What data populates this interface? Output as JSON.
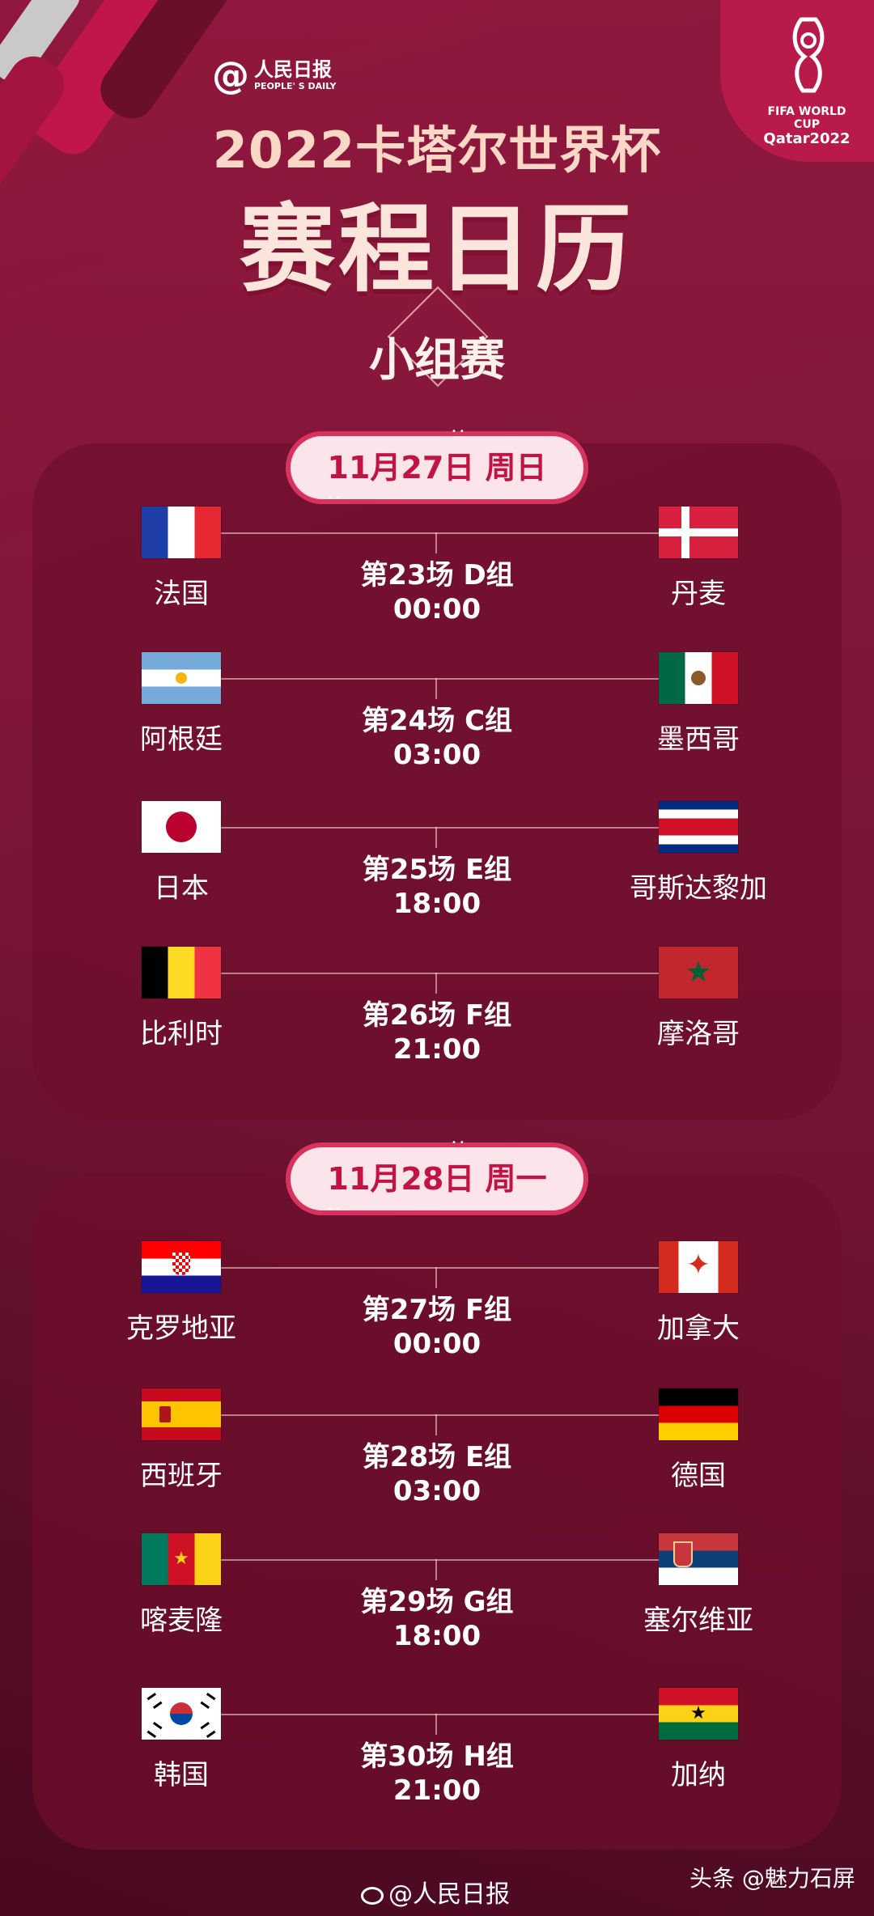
{
  "header": {
    "logo_mark": "@",
    "logo_cn": "人民日报",
    "logo_en": "PEOPLE' S DAILY",
    "fifa_line1": "FIFA WORLD CUP",
    "fifa_line2": "Qatar2022",
    "title_line1": "2022卡塔尔世界杯",
    "title_line2": "赛程日历",
    "stage": "小组赛"
  },
  "days": [
    {
      "date": "11月27日 周日",
      "matches": [
        {
          "home": "法国",
          "away": "丹麦",
          "info": "第23场 D组",
          "time": "00:00",
          "home_flag": "france-flag",
          "away_flag": "denmark-flag"
        },
        {
          "home": "阿根廷",
          "away": "墨西哥",
          "info": "第24场 C组",
          "time": "03:00",
          "home_flag": "argentina-flag",
          "away_flag": "mexico-flag"
        },
        {
          "home": "日本",
          "away": "哥斯达黎加",
          "info": "第25场 E组",
          "time": "18:00",
          "home_flag": "japan-flag",
          "away_flag": "costa-rica-flag"
        },
        {
          "home": "比利时",
          "away": "摩洛哥",
          "info": "第26场 F组",
          "time": "21:00",
          "home_flag": "belgium-flag",
          "away_flag": "morocco-flag"
        }
      ]
    },
    {
      "date": "11月28日 周一",
      "matches": [
        {
          "home": "克罗地亚",
          "away": "加拿大",
          "info": "第27场 F组",
          "time": "00:00",
          "home_flag": "croatia-flag",
          "away_flag": "canada-flag"
        },
        {
          "home": "西班牙",
          "away": "德国",
          "info": "第28场 E组",
          "time": "03:00",
          "home_flag": "spain-flag",
          "away_flag": "germany-flag"
        },
        {
          "home": "喀麦隆",
          "away": "塞尔维亚",
          "info": "第29场 G组",
          "time": "18:00",
          "home_flag": "cameroon-flag",
          "away_flag": "serbia-flag"
        },
        {
          "home": "韩国",
          "away": "加纳",
          "info": "第30场 H组",
          "time": "21:00",
          "home_flag": "korea-flag",
          "away_flag": "ghana-flag"
        }
      ]
    }
  ],
  "footer": {
    "weibo": "@人民日报",
    "toutiao": "头条 @魅力石屏"
  },
  "colors": {
    "background": "#7a1635",
    "panel": "#6e0e2d",
    "pill_bg": "#fbe4ea",
    "pill_text": "#c21444",
    "title_light": "#fbd7c6"
  }
}
